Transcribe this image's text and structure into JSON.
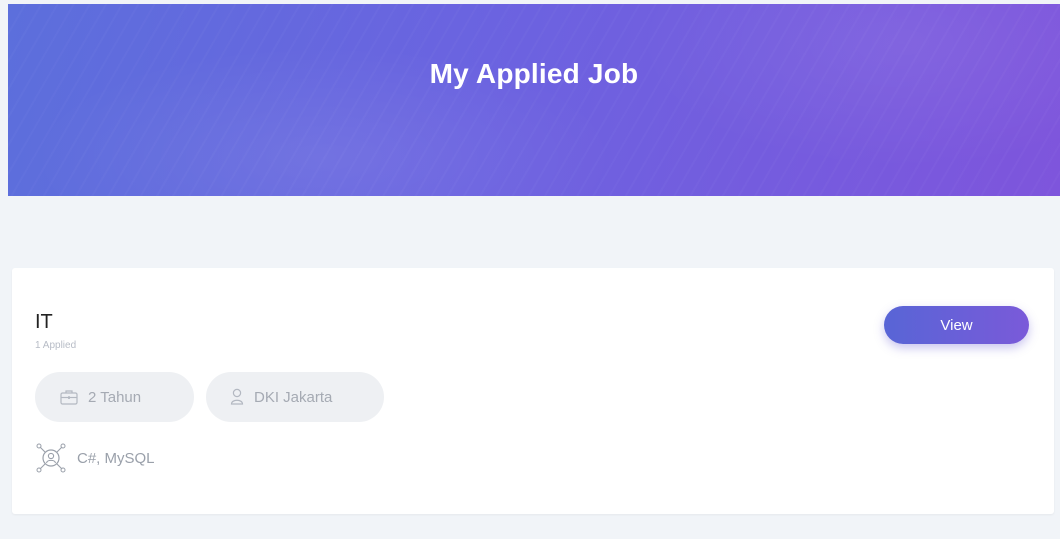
{
  "header": {
    "title": "My Applied Job"
  },
  "job": {
    "title": "IT",
    "applied": "1 Applied",
    "experience": "2 Tahun",
    "location": "DKI Jakarta",
    "skills": "C#, MySQL",
    "view_label": "View"
  },
  "colors": {
    "hero_start": "#5c6fdc",
    "hero_end": "#7e55dc",
    "button_start": "#5865d6",
    "button_end": "#7a5ad9",
    "page_background": "#f1f4f8"
  },
  "icons": {
    "experience": "briefcase-icon",
    "location": "user-location-icon",
    "skills": "skills-network-icon"
  }
}
